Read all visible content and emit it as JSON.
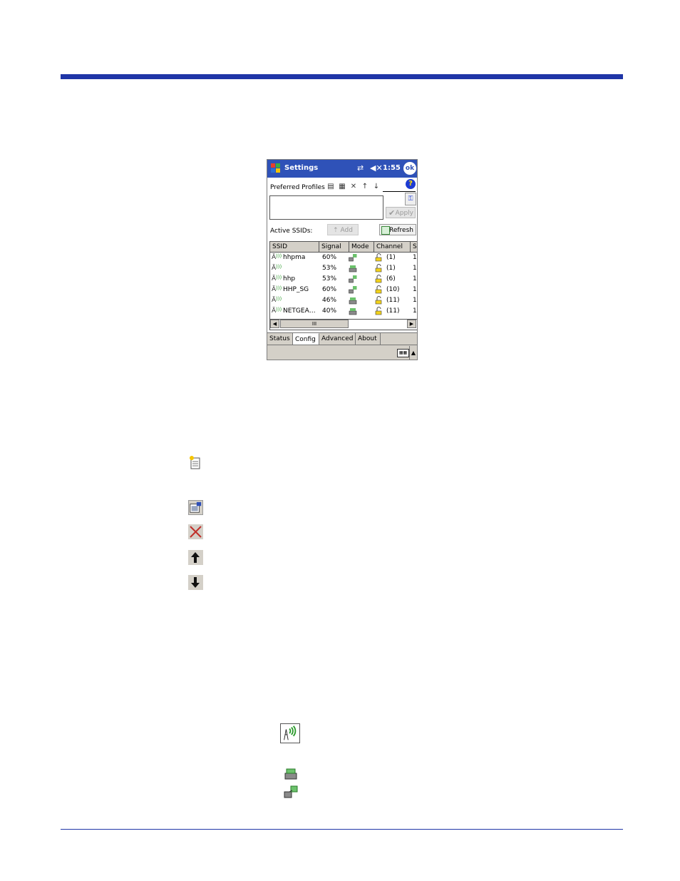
{
  "window": {
    "title": "Settings",
    "time": "1:55",
    "ok_label": "ok",
    "help_label": "?"
  },
  "config": {
    "preferred_profiles_label": "Preferred Profiles",
    "apply_label": "Apply",
    "active_ssids_label": "Active SSIDs:",
    "add_label": "Add",
    "refresh_label": "Refresh"
  },
  "table": {
    "headers": [
      "SSID",
      "Signal",
      "Mode",
      "Channel",
      "S"
    ],
    "rows": [
      {
        "ssid": "hhpma",
        "signal": "60%",
        "mode": "infrastructure",
        "channel": "(1)",
        "extra": "1"
      },
      {
        "ssid": "",
        "signal": "53%",
        "mode": "ad-hoc",
        "channel": "(1)",
        "extra": "1"
      },
      {
        "ssid": "hhp",
        "signal": "53%",
        "mode": "infrastructure",
        "channel": "(6)",
        "extra": "1"
      },
      {
        "ssid": "HHP_SG",
        "signal": "60%",
        "mode": "infrastructure",
        "channel": "(10)",
        "extra": "1"
      },
      {
        "ssid": "",
        "signal": "46%",
        "mode": "ad-hoc",
        "channel": "(11)",
        "extra": "1"
      },
      {
        "ssid": "NETGEA…",
        "signal": "40%",
        "mode": "ad-hoc",
        "channel": "(11)",
        "extra": "1"
      }
    ],
    "scroll_thumb": "III"
  },
  "tabs": [
    "Status",
    "Config",
    "Advanced",
    "About"
  ],
  "active_tab": "Config",
  "colors": {
    "title_bar": "#2f52b8",
    "rule": "#1f35a7",
    "chrome": "#d4d0c8"
  }
}
